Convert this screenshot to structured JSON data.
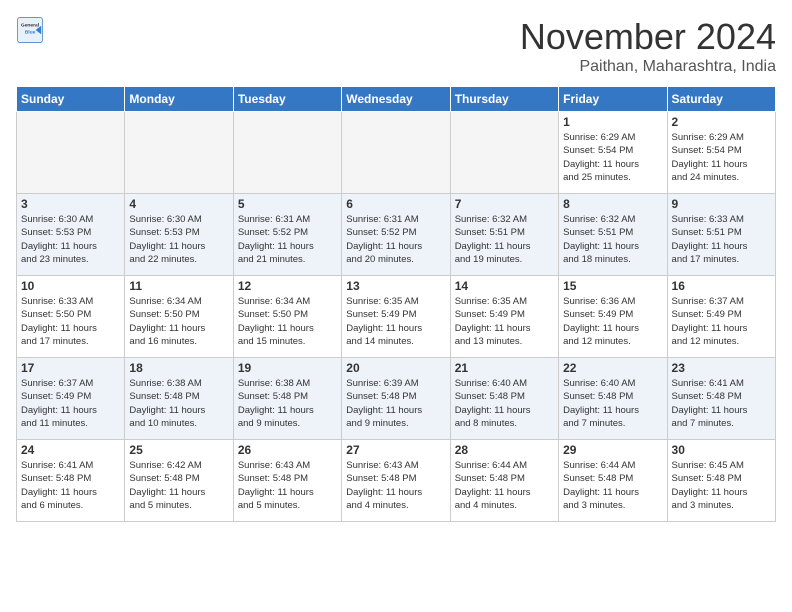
{
  "logo": {
    "general": "General",
    "blue": "Blue"
  },
  "title": "November 2024",
  "location": "Paithan, Maharashtra, India",
  "weekdays": [
    "Sunday",
    "Monday",
    "Tuesday",
    "Wednesday",
    "Thursday",
    "Friday",
    "Saturday"
  ],
  "weeks": [
    [
      {
        "day": "",
        "info": ""
      },
      {
        "day": "",
        "info": ""
      },
      {
        "day": "",
        "info": ""
      },
      {
        "day": "",
        "info": ""
      },
      {
        "day": "",
        "info": ""
      },
      {
        "day": "1",
        "info": "Sunrise: 6:29 AM\nSunset: 5:54 PM\nDaylight: 11 hours\nand 25 minutes."
      },
      {
        "day": "2",
        "info": "Sunrise: 6:29 AM\nSunset: 5:54 PM\nDaylight: 11 hours\nand 24 minutes."
      }
    ],
    [
      {
        "day": "3",
        "info": "Sunrise: 6:30 AM\nSunset: 5:53 PM\nDaylight: 11 hours\nand 23 minutes."
      },
      {
        "day": "4",
        "info": "Sunrise: 6:30 AM\nSunset: 5:53 PM\nDaylight: 11 hours\nand 22 minutes."
      },
      {
        "day": "5",
        "info": "Sunrise: 6:31 AM\nSunset: 5:52 PM\nDaylight: 11 hours\nand 21 minutes."
      },
      {
        "day": "6",
        "info": "Sunrise: 6:31 AM\nSunset: 5:52 PM\nDaylight: 11 hours\nand 20 minutes."
      },
      {
        "day": "7",
        "info": "Sunrise: 6:32 AM\nSunset: 5:51 PM\nDaylight: 11 hours\nand 19 minutes."
      },
      {
        "day": "8",
        "info": "Sunrise: 6:32 AM\nSunset: 5:51 PM\nDaylight: 11 hours\nand 18 minutes."
      },
      {
        "day": "9",
        "info": "Sunrise: 6:33 AM\nSunset: 5:51 PM\nDaylight: 11 hours\nand 17 minutes."
      }
    ],
    [
      {
        "day": "10",
        "info": "Sunrise: 6:33 AM\nSunset: 5:50 PM\nDaylight: 11 hours\nand 17 minutes."
      },
      {
        "day": "11",
        "info": "Sunrise: 6:34 AM\nSunset: 5:50 PM\nDaylight: 11 hours\nand 16 minutes."
      },
      {
        "day": "12",
        "info": "Sunrise: 6:34 AM\nSunset: 5:50 PM\nDaylight: 11 hours\nand 15 minutes."
      },
      {
        "day": "13",
        "info": "Sunrise: 6:35 AM\nSunset: 5:49 PM\nDaylight: 11 hours\nand 14 minutes."
      },
      {
        "day": "14",
        "info": "Sunrise: 6:35 AM\nSunset: 5:49 PM\nDaylight: 11 hours\nand 13 minutes."
      },
      {
        "day": "15",
        "info": "Sunrise: 6:36 AM\nSunset: 5:49 PM\nDaylight: 11 hours\nand 12 minutes."
      },
      {
        "day": "16",
        "info": "Sunrise: 6:37 AM\nSunset: 5:49 PM\nDaylight: 11 hours\nand 12 minutes."
      }
    ],
    [
      {
        "day": "17",
        "info": "Sunrise: 6:37 AM\nSunset: 5:49 PM\nDaylight: 11 hours\nand 11 minutes."
      },
      {
        "day": "18",
        "info": "Sunrise: 6:38 AM\nSunset: 5:48 PM\nDaylight: 11 hours\nand 10 minutes."
      },
      {
        "day": "19",
        "info": "Sunrise: 6:38 AM\nSunset: 5:48 PM\nDaylight: 11 hours\nand 9 minutes."
      },
      {
        "day": "20",
        "info": "Sunrise: 6:39 AM\nSunset: 5:48 PM\nDaylight: 11 hours\nand 9 minutes."
      },
      {
        "day": "21",
        "info": "Sunrise: 6:40 AM\nSunset: 5:48 PM\nDaylight: 11 hours\nand 8 minutes."
      },
      {
        "day": "22",
        "info": "Sunrise: 6:40 AM\nSunset: 5:48 PM\nDaylight: 11 hours\nand 7 minutes."
      },
      {
        "day": "23",
        "info": "Sunrise: 6:41 AM\nSunset: 5:48 PM\nDaylight: 11 hours\nand 7 minutes."
      }
    ],
    [
      {
        "day": "24",
        "info": "Sunrise: 6:41 AM\nSunset: 5:48 PM\nDaylight: 11 hours\nand 6 minutes."
      },
      {
        "day": "25",
        "info": "Sunrise: 6:42 AM\nSunset: 5:48 PM\nDaylight: 11 hours\nand 5 minutes."
      },
      {
        "day": "26",
        "info": "Sunrise: 6:43 AM\nSunset: 5:48 PM\nDaylight: 11 hours\nand 5 minutes."
      },
      {
        "day": "27",
        "info": "Sunrise: 6:43 AM\nSunset: 5:48 PM\nDaylight: 11 hours\nand 4 minutes."
      },
      {
        "day": "28",
        "info": "Sunrise: 6:44 AM\nSunset: 5:48 PM\nDaylight: 11 hours\nand 4 minutes."
      },
      {
        "day": "29",
        "info": "Sunrise: 6:44 AM\nSunset: 5:48 PM\nDaylight: 11 hours\nand 3 minutes."
      },
      {
        "day": "30",
        "info": "Sunrise: 6:45 AM\nSunset: 5:48 PM\nDaylight: 11 hours\nand 3 minutes."
      }
    ]
  ]
}
